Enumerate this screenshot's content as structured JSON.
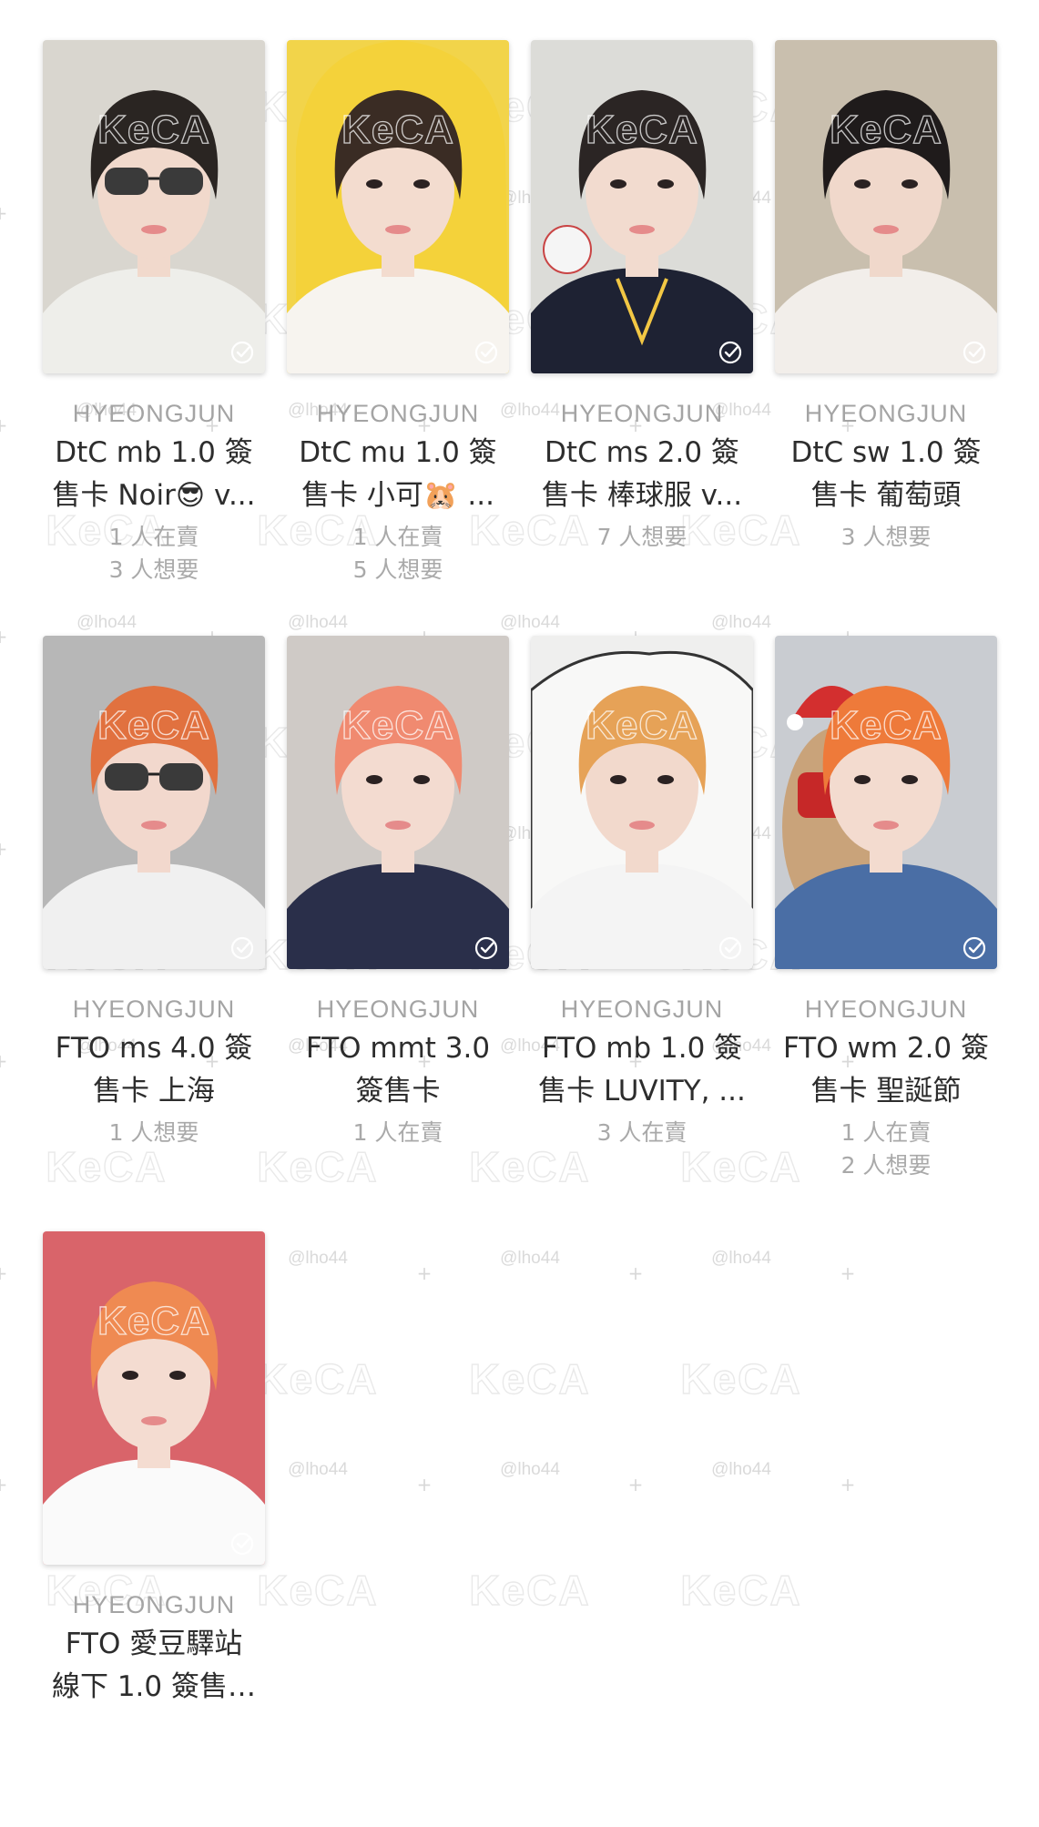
{
  "watermark": {
    "logo": "KeCA",
    "handle": "@lho44"
  },
  "cards": [
    {
      "member": "HYEONGJUN",
      "title_line1": "DtC mb 1.0 簽",
      "title_line2": "售卡 Noir😎 v...",
      "stats": [
        "1 人在賣",
        "3 人想要"
      ],
      "colors": {
        "bg": "#d9d6cf",
        "hair": "#2a2522",
        "shirt": "#eeeeea",
        "skin": "#f1d9cc"
      },
      "prop": "sunglasses"
    },
    {
      "member": "HYEONGJUN",
      "title_line1": "DtC mu 1.0 簽",
      "title_line2": "售卡 小可🐹 ...",
      "stats": [
        "1 人在賣",
        "5 人想要"
      ],
      "colors": {
        "bg": "#f2d44a",
        "hair": "#3a2c24",
        "shirt": "#f7f4ef",
        "skin": "#f3dccf"
      },
      "prop": "yellow-hood"
    },
    {
      "member": "HYEONGJUN",
      "title_line1": "DtC ms 2.0 簽",
      "title_line2": "售卡 棒球服 v...",
      "stats": [
        "7 人想要"
      ],
      "colors": {
        "bg": "#dcdcd8",
        "hair": "#2b2524",
        "shirt": "#1e2233",
        "skin": "#f2dbcf"
      },
      "prop": "baseball"
    },
    {
      "member": "HYEONGJUN",
      "title_line1": "DtC sw 1.0 簽",
      "title_line2": "售卡 葡萄頭",
      "stats": [
        "3 人想要"
      ],
      "colors": {
        "bg": "#c9bfae",
        "hair": "#1f1b1b",
        "shirt": "#f2eeea",
        "skin": "#f0d8cb"
      },
      "prop": "none"
    },
    {
      "member": "HYEONGJUN",
      "title_line1": "FTO ms 4.0 簽",
      "title_line2": "售卡 上海",
      "stats": [
        "1 人想要"
      ],
      "colors": {
        "bg": "#b7b7b7",
        "hair": "#e1713f",
        "shirt": "#f0f0f0",
        "skin": "#f2d8cd"
      },
      "prop": "goggles"
    },
    {
      "member": "HYEONGJUN",
      "title_line1": "FTO mmt 3.0",
      "title_line2": "簽售卡",
      "stats": [
        "1 人在賣"
      ],
      "colors": {
        "bg": "#cfcac6",
        "hair": "#f08a70",
        "shirt": "#2a2f4a",
        "skin": "#f3dbd0"
      },
      "prop": "none"
    },
    {
      "member": "HYEONGJUN",
      "title_line1": "FTO mb 1.0 簽",
      "title_line2": "售卡 LUVITY, ...",
      "stats": [
        "3 人在賣"
      ],
      "colors": {
        "bg": "#efefee",
        "hair": "#e6a257",
        "shirt": "#f4f4f4",
        "skin": "#f2d9cc"
      },
      "prop": "blanket"
    },
    {
      "member": "HYEONGJUN",
      "title_line1": "FTO wm 2.0 簽",
      "title_line2": "售卡 聖誕節",
      "stats": [
        "1 人在賣",
        "2 人想要"
      ],
      "colors": {
        "bg": "#c9ccd1",
        "hair": "#ee7a3a",
        "shirt": "#4a6ea5",
        "skin": "#f3dbcf"
      },
      "prop": "teddy"
    },
    {
      "member": "HYEONGJUN",
      "title_line1": "FTO 愛豆驛站",
      "title_line2": "線下 1.0 簽售…",
      "stats": [],
      "colors": {
        "bg": "#d9646a",
        "hair": "#ef8a52",
        "shirt": "#fafafa",
        "skin": "#f4dcd1"
      },
      "prop": "none"
    }
  ]
}
